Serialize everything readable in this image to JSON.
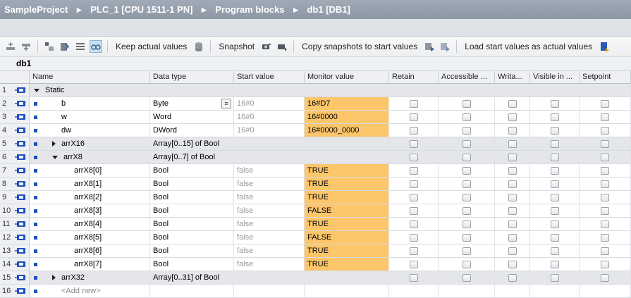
{
  "breadcrumb": {
    "items": [
      "SampleProject",
      "PLC_1 [CPU 1511-1 PN]",
      "Program blocks",
      "db1 [DB1]"
    ],
    "sep": "►"
  },
  "toolbar": {
    "keep_actual": "Keep actual values",
    "snapshot": "Snapshot",
    "copy_snapshots": "Copy snapshots to start values",
    "load_start": "Load start values as actual values"
  },
  "block_title": "db1",
  "columns": [
    "Name",
    "Data type",
    "Start value",
    "Monitor value",
    "Retain",
    "Accessible ...",
    "Writa...",
    "Visible in ...",
    "Setpoint"
  ],
  "rows": [
    {
      "num": "1",
      "level": 0,
      "expander": "expanded",
      "name": "Static",
      "type": "",
      "start": "",
      "monitor": ""
    },
    {
      "num": "2",
      "level": 1,
      "expander": "",
      "name": "b",
      "type": "Byte",
      "start": "16#0",
      "monitor": "16#D7",
      "dropdown": true
    },
    {
      "num": "3",
      "level": 1,
      "expander": "",
      "name": "w",
      "type": "Word",
      "start": "16#0",
      "monitor": "16#0000"
    },
    {
      "num": "4",
      "level": 1,
      "expander": "",
      "name": "dw",
      "type": "DWord",
      "start": "16#0",
      "monitor": "16#0000_0000"
    },
    {
      "num": "5",
      "level": 1,
      "expander": "collapsed",
      "name": "arrX16",
      "type": "Array[0..15] of Bool",
      "start": "",
      "monitor": ""
    },
    {
      "num": "6",
      "level": 1,
      "expander": "expanded",
      "name": "arrX8",
      "type": "Array[0..7] of Bool",
      "start": "",
      "monitor": ""
    },
    {
      "num": "7",
      "level": 2,
      "expander": "",
      "name": "arrX8[0]",
      "type": "Bool",
      "start": "false",
      "monitor": "TRUE"
    },
    {
      "num": "8",
      "level": 2,
      "expander": "",
      "name": "arrX8[1]",
      "type": "Bool",
      "start": "false",
      "monitor": "TRUE"
    },
    {
      "num": "9",
      "level": 2,
      "expander": "",
      "name": "arrX8[2]",
      "type": "Bool",
      "start": "false",
      "monitor": "TRUE"
    },
    {
      "num": "10",
      "level": 2,
      "expander": "",
      "name": "arrX8[3]",
      "type": "Bool",
      "start": "false",
      "monitor": "FALSE"
    },
    {
      "num": "11",
      "level": 2,
      "expander": "",
      "name": "arrX8[4]",
      "type": "Bool",
      "start": "false",
      "monitor": "TRUE"
    },
    {
      "num": "12",
      "level": 2,
      "expander": "",
      "name": "arrX8[5]",
      "type": "Bool",
      "start": "false",
      "monitor": "FALSE"
    },
    {
      "num": "13",
      "level": 2,
      "expander": "",
      "name": "arrX8[6]",
      "type": "Bool",
      "start": "false",
      "monitor": "TRUE"
    },
    {
      "num": "14",
      "level": 2,
      "expander": "",
      "name": "arrX8[7]",
      "type": "Bool",
      "start": "false",
      "monitor": "TRUE"
    },
    {
      "num": "15",
      "level": 1,
      "expander": "collapsed",
      "name": "arrX32",
      "type": "Array[0..31] of Bool",
      "start": "",
      "monitor": ""
    },
    {
      "num": "16",
      "level": 1,
      "expander": "",
      "name": "<Add new>",
      "type": "",
      "start": "",
      "monitor": "",
      "addnew": true
    }
  ],
  "colors": {
    "monitor_bg": "#fdc66a",
    "breadcrumb_bg": "#949dab",
    "icon_blue": "#1d4fbf"
  }
}
